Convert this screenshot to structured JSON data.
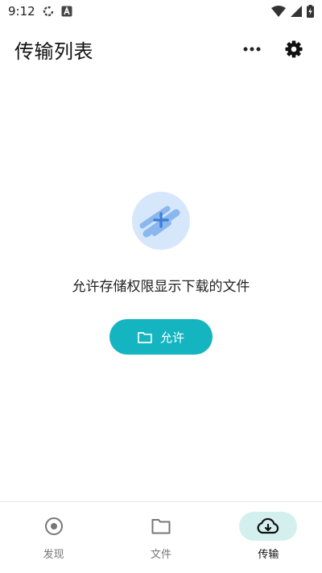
{
  "status_bar": {
    "time": "9:12"
  },
  "header": {
    "title": "传输列表",
    "more_icon": "more-horizontal-icon",
    "settings_icon": "gear-icon"
  },
  "empty_state": {
    "message": "允许存储权限显示下载的文件",
    "button_label": "允许",
    "button_icon": "folder-icon"
  },
  "bottom_nav": {
    "items": [
      {
        "label": "发现",
        "icon": "discover-icon"
      },
      {
        "label": "文件",
        "icon": "folder-icon"
      },
      {
        "label": "传输",
        "icon": "cloud-download-icon",
        "active": true
      }
    ]
  },
  "colors": {
    "accent": "#14b5c1",
    "active_pill": "#d4f0ee",
    "illustration_bg": "#d6e7fb"
  }
}
